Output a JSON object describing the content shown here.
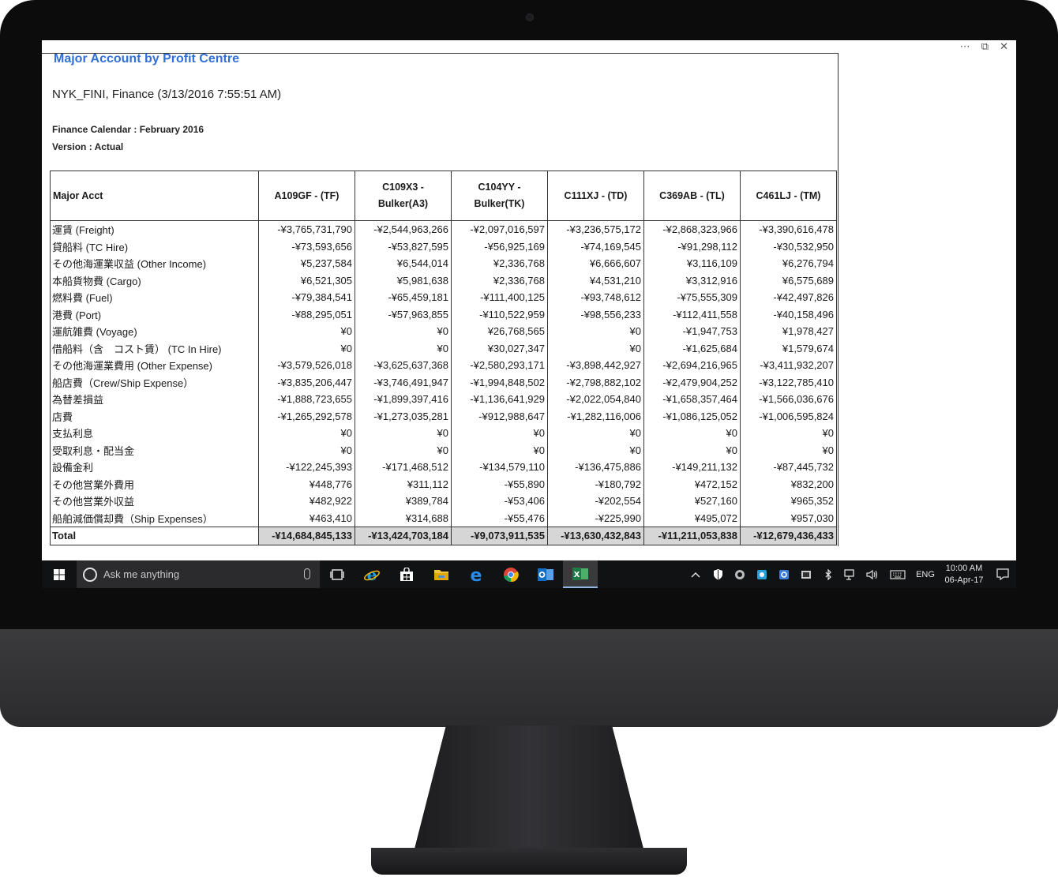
{
  "window": {
    "controls": [
      "⋯",
      "⧉",
      "✕"
    ]
  },
  "report": {
    "title": "Major Account by Profit Centre",
    "subtitle": "NYK_FINI, Finance (3/13/2016 7:55:51 AM)",
    "calendar": "Finance Calendar : February 2016",
    "version": "Version : Actual"
  },
  "table": {
    "headers": [
      "Major Acct",
      "A109GF - (TF)",
      "C109X3 - Bulker(A3)",
      "C104YY - Bulker(TK)",
      "C111XJ - (TD)",
      "C369AB - (TL)",
      "C461LJ - (TM)"
    ],
    "rows": [
      [
        "運賃 (Freight)",
        "-¥3,765,731,790",
        "-¥2,544,963,266",
        "-¥2,097,016,597",
        "-¥3,236,575,172",
        "-¥2,868,323,966",
        "-¥3,390,616,478"
      ],
      [
        "貸船料 (TC Hire)",
        "-¥73,593,656",
        "-¥53,827,595",
        "-¥56,925,169",
        "-¥74,169,545",
        "-¥91,298,112",
        "-¥30,532,950"
      ],
      [
        "その他海運業収益 (Other Income)",
        "¥5,237,584",
        "¥6,544,014",
        "¥2,336,768",
        "¥6,666,607",
        "¥3,116,109",
        "¥6,276,794"
      ],
      [
        "本船貨物費 (Cargo)",
        "¥6,521,305",
        "¥5,981,638",
        "¥2,336,768",
        "¥4,531,210",
        "¥3,312,916",
        "¥6,575,689"
      ],
      [
        "燃料費 (Fuel)",
        "-¥79,384,541",
        "-¥65,459,181",
        "-¥111,400,125",
        "-¥93,748,612",
        "-¥75,555,309",
        "-¥42,497,826"
      ],
      [
        "港費 (Port)",
        "-¥88,295,051",
        "-¥57,963,855",
        "-¥110,522,959",
        "-¥98,556,233",
        "-¥112,411,558",
        "-¥40,158,496"
      ],
      [
        "運航雑費 (Voyage)",
        "¥0",
        "¥0",
        "¥26,768,565",
        "¥0",
        "-¥1,947,753",
        "¥1,978,427"
      ],
      [
        "借船料（含　コスト賃） (TC In Hire)",
        "¥0",
        "¥0",
        "¥30,027,347",
        "¥0",
        "-¥1,625,684",
        "¥1,579,674"
      ],
      [
        "その他海運業費用 (Other Expense)",
        "-¥3,579,526,018",
        "-¥3,625,637,368",
        "-¥2,580,293,171",
        "-¥3,898,442,927",
        "-¥2,694,216,965",
        "-¥3,411,932,207"
      ],
      [
        "船店費（Crew/Ship Expense）",
        "-¥3,835,206,447",
        "-¥3,746,491,947",
        "-¥1,994,848,502",
        "-¥2,798,882,102",
        "-¥2,479,904,252",
        "-¥3,122,785,410"
      ],
      [
        "為替差損益",
        "-¥1,888,723,655",
        "-¥1,899,397,416",
        "-¥1,136,641,929",
        "-¥2,022,054,840",
        "-¥1,658,357,464",
        "-¥1,566,036,676"
      ],
      [
        "店費",
        "-¥1,265,292,578",
        "-¥1,273,035,281",
        "-¥912,988,647",
        "-¥1,282,116,006",
        "-¥1,086,125,052",
        "-¥1,006,595,824"
      ],
      [
        "支払利息",
        "¥0",
        "¥0",
        "¥0",
        "¥0",
        "¥0",
        "¥0"
      ],
      [
        "受取利息・配当金",
        "¥0",
        "¥0",
        "¥0",
        "¥0",
        "¥0",
        "¥0"
      ],
      [
        "設備金利",
        "-¥122,245,393",
        "-¥171,468,512",
        "-¥134,579,110",
        "-¥136,475,886",
        "-¥149,211,132",
        "-¥87,445,732"
      ],
      [
        "その他営業外費用",
        "¥448,776",
        "¥311,112",
        "-¥55,890",
        "-¥180,792",
        "¥472,152",
        "¥832,200"
      ],
      [
        "その他営業外収益",
        "¥482,922",
        "¥389,784",
        "-¥53,406",
        "-¥202,554",
        "¥527,160",
        "¥965,352"
      ],
      [
        "船舶減価償却費（Ship Expenses）",
        "¥463,410",
        "¥314,688",
        "-¥55,476",
        "-¥225,990",
        "¥495,072",
        "¥957,030"
      ]
    ],
    "total": [
      "Total",
      "-¥14,684,845,133",
      "-¥13,424,703,184",
      "-¥9,073,911,535",
      "-¥13,630,432,843",
      "-¥11,211,053,838",
      "-¥12,679,436,433"
    ]
  },
  "taskbar": {
    "search_placeholder": "Ask me anything",
    "apps": [
      "task-view",
      "internet-explorer",
      "store",
      "file-explorer",
      "edge",
      "chrome",
      "outlook",
      "excel"
    ],
    "language": "ENG",
    "time": "10:00 AM",
    "date": "06-Apr-17"
  }
}
